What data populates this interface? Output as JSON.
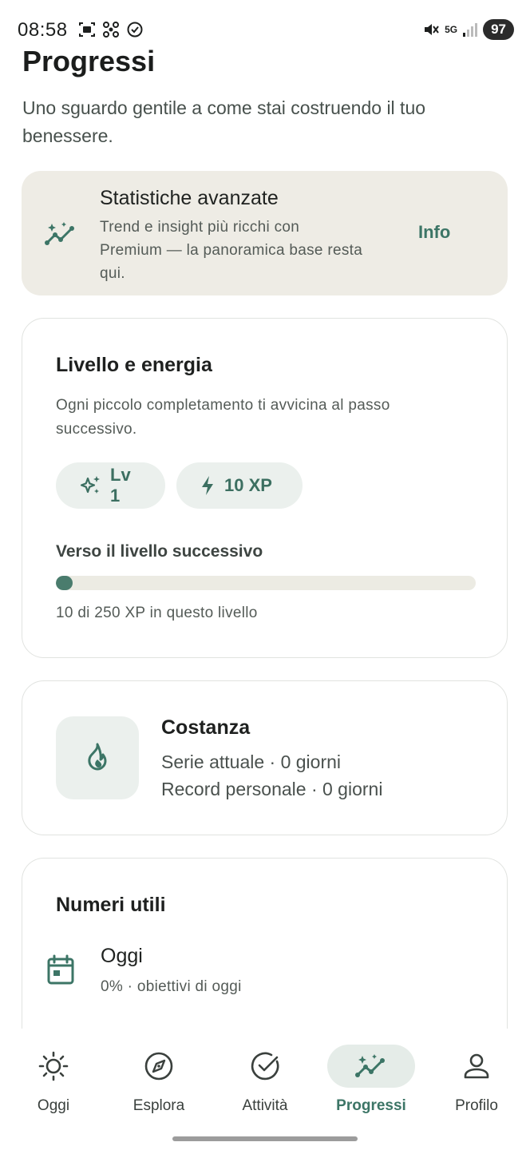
{
  "status_bar": {
    "time": "08:58",
    "network": "5G",
    "battery": "97",
    "colors": {
      "battery_bg": "#2b2b2b"
    }
  },
  "header": {
    "title": "Progressi",
    "subtitle": "Uno sguardo gentile a come stai costruendo il tuo benessere."
  },
  "premium": {
    "title": "Statistiche avanzate",
    "description": "Trend e insight più ricchi con Premium — la panoramica base resta qui.",
    "action": "Info",
    "icon": "trend-sparkle-icon"
  },
  "level": {
    "title": "Livello e energia",
    "description": "Ogni piccolo completamento ti avvicina al passo successivo.",
    "level_chip": "Lv 1",
    "xp_chip": "10 XP",
    "next_label": "Verso il livello successivo",
    "progress_current": 10,
    "progress_total": 250,
    "progress_text": "10 di 250 XP in questo livello"
  },
  "streak": {
    "title": "Costanza",
    "current": "Serie attuale · 0 giorni",
    "record": "Record personale · 0 giorni",
    "icon": "flame-icon"
  },
  "numbers": {
    "title": "Numeri utili",
    "today_title": "Oggi",
    "today_desc": "0% · obiettivi di oggi",
    "icon": "calendar-icon"
  },
  "nav": {
    "items": [
      {
        "label": "Oggi",
        "icon": "sun-icon"
      },
      {
        "label": "Esplora",
        "icon": "compass-icon"
      },
      {
        "label": "Attività",
        "icon": "check-circle-icon"
      },
      {
        "label": "Progressi",
        "icon": "trend-sparkle-icon",
        "active": true
      },
      {
        "label": "Profilo",
        "icon": "person-icon"
      }
    ]
  },
  "colors": {
    "accent": "#3c7566",
    "progress_fill": "#4a7c6d",
    "premium_bg": "#eeece5",
    "chip_bg": "#ebf0ed"
  }
}
